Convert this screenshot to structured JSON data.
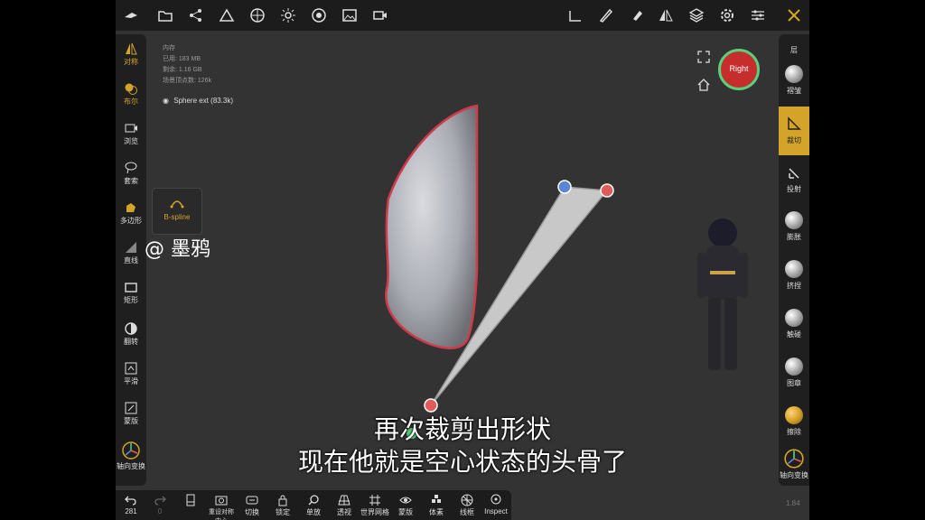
{
  "stats": {
    "title": "内存",
    "used": "已用: 183 MB",
    "remaining": "剩余: 1.16 GB",
    "vertices": "场景顶点数: 126k"
  },
  "mesh": {
    "name": "Sphere ext (83.3k)"
  },
  "left_tools": [
    {
      "label": "对称",
      "icon": "symmetry-icon"
    },
    {
      "label": "布尔",
      "icon": "boolean-icon"
    },
    {
      "label": "浏览",
      "icon": "camera-icon"
    },
    {
      "label": "套索",
      "icon": "lasso-icon"
    },
    {
      "label": "多边形",
      "icon": "polygon-icon"
    },
    {
      "label": "直线",
      "icon": "line-icon"
    },
    {
      "label": "矩形",
      "icon": "rectangle-icon"
    },
    {
      "label": "翻转",
      "icon": "flip-icon"
    },
    {
      "label": "平滑",
      "icon": "smooth-icon"
    },
    {
      "label": "蒙版",
      "icon": "mask-icon"
    },
    {
      "label": "轴向变换",
      "icon": "gizmo-icon"
    }
  ],
  "popup": {
    "label": "B-spline"
  },
  "right_tools": [
    {
      "label": "层"
    },
    {
      "label": "褶皱"
    },
    {
      "label": "裁切"
    },
    {
      "label": "投射"
    },
    {
      "label": "膨胀"
    },
    {
      "label": "挤捏"
    },
    {
      "label": "触碰"
    },
    {
      "label": "图章"
    },
    {
      "label": "擦除"
    },
    {
      "label": "轴向变换"
    }
  ],
  "right_bottom_value": "1.84",
  "viewcube": {
    "label": "Right"
  },
  "bottom_tools": [
    {
      "label": "281"
    },
    {
      "label": "0"
    },
    {
      "label": ""
    },
    {
      "label": "重设对称中心"
    },
    {
      "label": "切换"
    },
    {
      "label": "锁定"
    },
    {
      "label": "单放"
    },
    {
      "label": "透视"
    },
    {
      "label": "世界网格"
    },
    {
      "label": "蒙版"
    },
    {
      "label": "体素"
    },
    {
      "label": "线框"
    },
    {
      "label": "Inspect"
    }
  ],
  "watermark": "@ 墨鸦",
  "subtitles": {
    "line1": "再次裁剪出形状",
    "line2": "现在他就是空心状态的头骨了"
  },
  "colors": {
    "accent": "#d4a32a",
    "cut_outline": "#d23a4a"
  }
}
